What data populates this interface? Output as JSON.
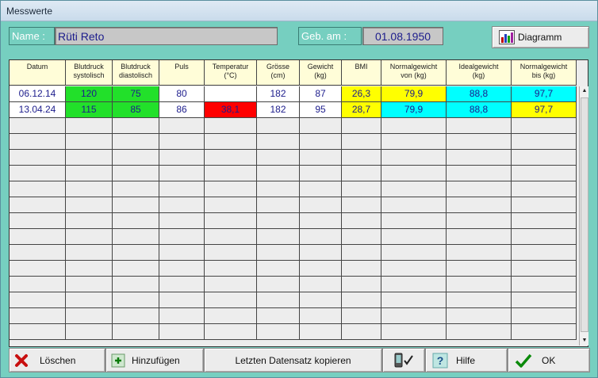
{
  "window": {
    "title": "Messwerte"
  },
  "patient": {
    "name_label": "Name :",
    "name_value": "Rüti Reto",
    "dob_label": "Geb. am :",
    "dob_value": "01.08.1950"
  },
  "toolbar": {
    "diagram_label": "Diagramm"
  },
  "table": {
    "columns": [
      {
        "key": "datum",
        "header1": "Datum",
        "header2": ""
      },
      {
        "key": "sys",
        "header1": "Blutdruck",
        "header2": "systolisch"
      },
      {
        "key": "dia",
        "header1": "Blutdruck",
        "header2": "diastolisch"
      },
      {
        "key": "puls",
        "header1": "Puls",
        "header2": ""
      },
      {
        "key": "temp",
        "header1": "Temperatur",
        "header2": "(°C)"
      },
      {
        "key": "groesse",
        "header1": "Grösse",
        "header2": "(cm)"
      },
      {
        "key": "gewicht",
        "header1": "Gewicht",
        "header2": "(kg)"
      },
      {
        "key": "bmi",
        "header1": "BMI",
        "header2": ""
      },
      {
        "key": "normvon",
        "header1": "Normalgewicht",
        "header2": "von (kg)"
      },
      {
        "key": "ideal",
        "header1": "Idealgewicht",
        "header2": "(kg)"
      },
      {
        "key": "normbis",
        "header1": "Normalgewicht",
        "header2": "bis (kg)"
      }
    ],
    "rows": [
      {
        "datum": "06.12.14",
        "sys": "120",
        "dia": "75",
        "puls": "80",
        "temp": "",
        "groesse": "182",
        "gewicht": "87",
        "bmi": "26,3",
        "normvon": "79,9",
        "ideal": "88,8",
        "normbis": "97,7"
      },
      {
        "datum": "13.04.24",
        "sys": "115",
        "dia": "85",
        "puls": "86",
        "temp": "38,1",
        "groesse": "182",
        "gewicht": "95",
        "bmi": "28,7",
        "normvon": "79,9",
        "ideal": "88,8",
        "normbis": "97,7"
      }
    ],
    "cell_colors": [
      {
        "datum": "#ffffff",
        "sys": "#22e02a",
        "dia": "#22e02a",
        "puls": "#ffffff",
        "temp": "#ffffff",
        "groesse": "#ffffff",
        "gewicht": "#ffffff",
        "bmi": "#ffff00",
        "normvon": "#ffff00",
        "ideal": "#00ffff",
        "normbis": "#00ffff"
      },
      {
        "datum": "#ffffff",
        "sys": "#22e02a",
        "dia": "#22e02a",
        "puls": "#ffffff",
        "temp": "#ff0000",
        "groesse": "#ffffff",
        "gewicht": "#ffffff",
        "bmi": "#ffff00",
        "normvon": "#00ffff",
        "ideal": "#00ffff",
        "normbis": "#ffff00"
      }
    ]
  },
  "buttons": {
    "delete_label": "Löschen",
    "add_label": "Hinzufügen",
    "copy_label": "Letzten Datensatz kopieren",
    "help_label": "Hilfe",
    "ok_label": "OK"
  },
  "icons": {
    "delete": "x-icon",
    "add": "plus-icon",
    "diagram": "bar-chart-icon",
    "mobile": "mobile-check-icon",
    "help": "question-icon",
    "ok": "checkmark-icon"
  },
  "colors": {
    "background": "#76cfc0",
    "header_row": "#fffdd8",
    "empty_row": "#ededed",
    "text_blue": "#1c1c8c"
  }
}
